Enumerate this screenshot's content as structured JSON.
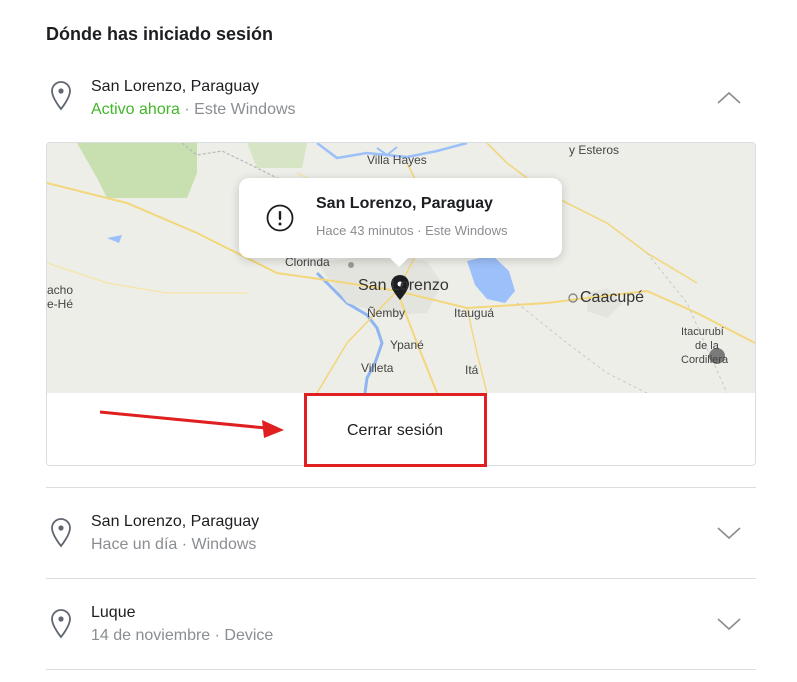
{
  "heading": "Dónde has iniciado sesión",
  "sessions": [
    {
      "location": "San Lorenzo, Paraguay",
      "status": "Activo ahora",
      "separator": " · ",
      "device": "Este Windows",
      "expanded": true
    },
    {
      "location": "San Lorenzo, Paraguay",
      "status": "Hace un día",
      "separator": " · ",
      "device": "Windows",
      "expanded": false
    },
    {
      "location": "Luque",
      "status": "14 de noviembre",
      "separator": " · ",
      "device": "Device",
      "expanded": false
    }
  ],
  "map": {
    "labels": {
      "villa_hayes": "Villa Hayes",
      "y_esteros": "y Esteros",
      "clorinda": "Clorinda",
      "san_lorenzo": "San Lorenzo",
      "nemby": "Ñemby",
      "itaugua": "Itauguá",
      "caacupe": "Caacupé",
      "ypane": "Ypané",
      "villeta": "Villeta",
      "ita": "Itá",
      "itacurubi_1": "Itacurubí",
      "itacurubi_2": "de la",
      "itacurubi_3": "Cordillera",
      "nacho_1": "acho",
      "nacho_2": "e-Hé"
    },
    "popup": {
      "title": "San Lorenzo, Paraguay",
      "subtitle": "Hace 43 minutos · Este Windows"
    }
  },
  "actions": {
    "logout_label": "Cerrar sesión"
  },
  "colors": {
    "active": "#42b72a",
    "muted": "#8a8d91",
    "highlight": "#e02020",
    "water": "#9cc0f9",
    "park": "#c8dfb0"
  }
}
